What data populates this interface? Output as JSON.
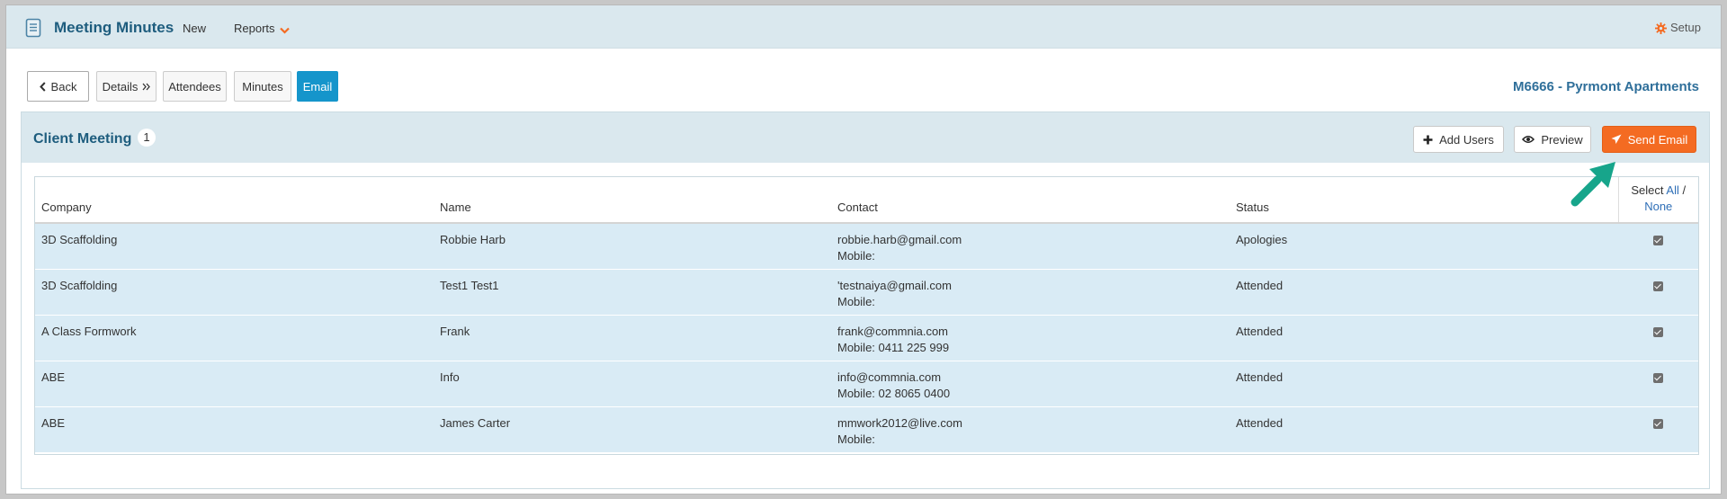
{
  "nav": {
    "app_title": "Meeting Minutes",
    "new_label": "New",
    "reports_label": "Reports",
    "setup_label": "Setup",
    "accent_color": "#f46b22"
  },
  "tabs": {
    "back": "Back",
    "details": "Details",
    "attendees": "Attendees",
    "minutes": "Minutes",
    "email": "Email",
    "active": "Email"
  },
  "project_title": "M6666 - Pyrmont Apartments",
  "panel": {
    "title": "Client Meeting",
    "count": "1",
    "add_users": "Add Users",
    "preview": "Preview",
    "send_email": "Send Email"
  },
  "table": {
    "headers": {
      "company": "Company",
      "name": "Name",
      "contact": "Contact",
      "status": "Status",
      "select": "Select",
      "all": "All",
      "sep": " /",
      "none": "None"
    },
    "rows": [
      {
        "company": "3D Scaffolding",
        "name": "Robbie Harb",
        "email": "robbie.harb@gmail.com",
        "mobile": "Mobile:",
        "status": "Apologies",
        "checked": true
      },
      {
        "company": "3D Scaffolding",
        "name": "Test1 Test1",
        "email": "'testnaiya@gmail.com",
        "mobile": "Mobile:",
        "status": "Attended",
        "checked": true
      },
      {
        "company": "A Class Formwork",
        "name": "Frank",
        "email": "frank@commnia.com",
        "mobile": "Mobile: 0411 225 999",
        "status": "Attended",
        "checked": true
      },
      {
        "company": "ABE",
        "name": "Info",
        "email": "info@commnia.com",
        "mobile": "Mobile: 02 8065 0400",
        "status": "Attended",
        "checked": true
      },
      {
        "company": "ABE",
        "name": "James Carter",
        "email": "mmwork2012@live.com",
        "mobile": "Mobile:",
        "status": "Attended",
        "checked": true
      }
    ]
  },
  "icons": {
    "app": "document-icon",
    "reports_chevron": "chevron-down-icon",
    "setup": "gear-icon",
    "back": "chevron-left-icon",
    "details": "double-chevron-right-icon",
    "add_users": "plus-icon",
    "preview": "eye-icon",
    "send_email": "paper-plane-icon",
    "annotation": "arrow-icon"
  }
}
